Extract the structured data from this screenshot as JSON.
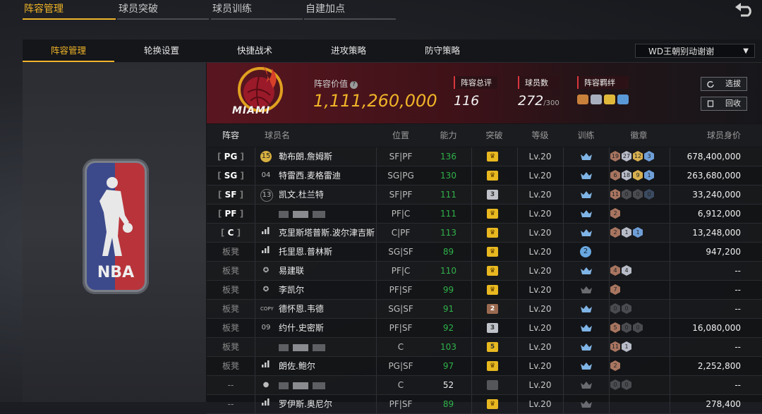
{
  "top_tabs": [
    {
      "label": "阵容管理",
      "active": true
    },
    {
      "label": "球员突破",
      "active": false
    },
    {
      "label": "球员训练",
      "active": false
    },
    {
      "label": "自建加点",
      "active": false
    }
  ],
  "sub_tabs": [
    {
      "label": "阵容管理",
      "active": true
    },
    {
      "label": "轮换设置",
      "active": false
    },
    {
      "label": "快捷战术",
      "active": false
    },
    {
      "label": "进攻策略",
      "active": false
    },
    {
      "label": "防守策略",
      "active": false
    }
  ],
  "dropdown": {
    "selected": "WD王朝别动谢谢"
  },
  "team": {
    "logo_text": "MIAMI",
    "league_logo_text": "NBA",
    "value_label": "阵容价值",
    "value": "1,111,260,000",
    "overall_label": "阵容总评",
    "overall": "116",
    "players_label": "球员数",
    "players": "272",
    "players_cap": "/300",
    "bond_label": "阵容羁绊",
    "select_button": "选拔",
    "recycle_button": "回收"
  },
  "colors": {
    "accent": "#f0b428",
    "rating": "#2fb24a",
    "header_red": "#5a1620"
  },
  "columns": [
    "阵容",
    "球员名",
    "位置",
    "能力",
    "突破",
    "等级",
    "训练",
    "徽章",
    "球员身价"
  ],
  "rows": [
    {
      "slot": "PG",
      "starter": true,
      "jersey": "15",
      "name": "勒布朗.詹姆斯",
      "pos": "SF|PF",
      "rating": "136",
      "brk": "crown",
      "level": "Lv.20",
      "badges": [
        {
          "t": "19",
          "c": "bronze"
        },
        {
          "t": "27",
          "c": "silver"
        },
        {
          "t": "12",
          "c": "gold"
        },
        {
          "t": "3",
          "c": "blue"
        }
      ],
      "worth": "678,400,000"
    },
    {
      "slot": "SG",
      "starter": true,
      "jersey": "04",
      "name": "特雷西.麦格雷迪",
      "pos": "SG|PG",
      "rating": "130",
      "brk": "crown",
      "level": "Lv.20",
      "badges": [
        {
          "t": "6",
          "c": "bronze"
        },
        {
          "t": "18",
          "c": "silver"
        },
        {
          "t": "9",
          "c": "gold"
        },
        {
          "t": "1",
          "c": "blue"
        }
      ],
      "worth": "263,680,000"
    },
    {
      "slot": "SF",
      "starter": true,
      "jersey": "13",
      "name": "凯文.杜兰特",
      "pos": "SF|PF",
      "rating": "111",
      "brk": "3",
      "level": "Lv.20",
      "badges": [
        {
          "t": "11",
          "c": "bronze"
        },
        {
          "t": "0",
          "c": "dark"
        },
        {
          "t": "0",
          "c": "dark"
        },
        {
          "t": "0",
          "c": "darkblue"
        }
      ],
      "worth": "33,240,000"
    },
    {
      "slot": "PF",
      "starter": true,
      "jersey": "",
      "name": "",
      "blurred": true,
      "pos": "PF|C",
      "rating": "111",
      "brk": "crown",
      "level": "Lv.20",
      "badges": [
        {
          "t": "2",
          "c": "bronze"
        }
      ],
      "worth": "6,912,000"
    },
    {
      "slot": "C",
      "starter": true,
      "jersey": "",
      "name": "克里斯塔普斯.波尔津吉斯",
      "pos": "C|PF",
      "rating": "113",
      "brk": "crown",
      "level": "Lv.20",
      "badges": [
        {
          "t": "2",
          "c": "bronze"
        },
        {
          "t": "1",
          "c": "silver"
        },
        {
          "t": "1",
          "c": "blue"
        }
      ],
      "worth": "13,248,000"
    },
    {
      "slot": "板凳",
      "starter": false,
      "jersey": "",
      "name": "托里恩.普林斯",
      "pos": "SG|SF",
      "rating": "89",
      "brk": "crown",
      "level": "Lv.20",
      "train": "2",
      "badges": [],
      "worth": "947,200"
    },
    {
      "slot": "板凳",
      "starter": false,
      "jersey": "",
      "name": "易建联",
      "pos": "PF|C",
      "rating": "110",
      "brk": "crown",
      "level": "Lv.20",
      "badges": [
        {
          "t": "4",
          "c": "bronze"
        },
        {
          "t": "4",
          "c": "silver"
        }
      ],
      "worth": "--"
    },
    {
      "slot": "板凳",
      "starter": false,
      "jersey": "",
      "name": "李凯尔",
      "pos": "PF|SF",
      "rating": "99",
      "brk": "crown",
      "level": "Lv.20",
      "badges": [
        {
          "t": "7",
          "c": "bronze"
        }
      ],
      "worth": "--"
    },
    {
      "slot": "板凳",
      "starter": false,
      "jersey": "COPY",
      "name": "德怀恩.韦德",
      "pos": "SG|SF",
      "rating": "91",
      "brk": "2",
      "level": "Lv.20",
      "badges": [
        {
          "t": "0",
          "c": "dark"
        },
        {
          "t": "0",
          "c": "dark"
        }
      ],
      "worth": "--"
    },
    {
      "slot": "板凳",
      "starter": false,
      "jersey": "09",
      "name": "约什.史密斯",
      "pos": "PF|SF",
      "rating": "92",
      "brk": "3",
      "level": "Lv.20",
      "badges": [
        {
          "t": "5",
          "c": "bronze"
        },
        {
          "t": "0",
          "c": "dark"
        },
        {
          "t": "0",
          "c": "dark"
        }
      ],
      "worth": "16,080,000"
    },
    {
      "slot": "板凳",
      "starter": false,
      "jersey": "",
      "name": "",
      "blurred": true,
      "pos": "C",
      "rating": "103",
      "brk": "5",
      "level": "Lv.20",
      "badges": [
        {
          "t": "11",
          "c": "bronze"
        },
        {
          "t": "1",
          "c": "silver"
        }
      ],
      "worth": "--"
    },
    {
      "slot": "板凳",
      "starter": false,
      "jersey": "",
      "name": "朗佐.鲍尔",
      "pos": "PG|SF",
      "rating": "97",
      "brk": "crown",
      "level": "Lv.20",
      "badges": [
        {
          "t": "2",
          "c": "bronze"
        }
      ],
      "worth": "2,252,800"
    },
    {
      "slot": "--",
      "starter": false,
      "jersey": "",
      "name": "",
      "blurred": true,
      "pos": "C",
      "rating": "52",
      "rating_white": true,
      "brk": "grey",
      "level": "Lv.20",
      "badges": [
        {
          "t": "0",
          "c": "dark"
        },
        {
          "t": "0",
          "c": "dark"
        }
      ],
      "worth": "--"
    },
    {
      "slot": "--",
      "starter": false,
      "jersey": "",
      "name": "罗伊斯.奥尼尔",
      "pos": "PF|SF",
      "rating": "89",
      "brk": "crown",
      "level": "Lv.20",
      "badges": [],
      "worth": "278,400"
    }
  ]
}
